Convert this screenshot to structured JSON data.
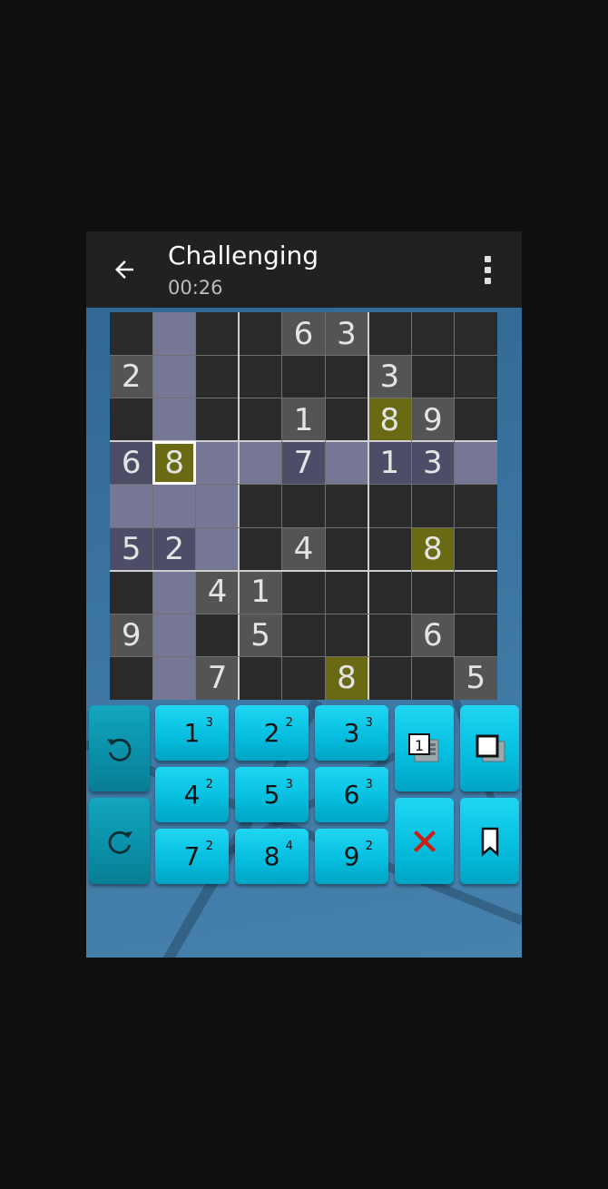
{
  "toolbar": {
    "title": "Challenging",
    "timer": "00:26",
    "back_icon": "arrow-left-icon",
    "menu_icon": "more-vertical-icon"
  },
  "colors": {
    "given": "#545454",
    "empty": "#2a2a2a",
    "highlight": "#767695",
    "highlight_given": "#4d4d68",
    "match": "#6a6a14"
  },
  "board": {
    "rows": [
      [
        "",
        "",
        "",
        "",
        "6",
        "3",
        "",
        "",
        ""
      ],
      [
        "2",
        "",
        "",
        "",
        "",
        "",
        "3",
        "",
        ""
      ],
      [
        "",
        "",
        "",
        "",
        "1",
        "",
        "8",
        "9",
        ""
      ],
      [
        "6",
        "8",
        "",
        "",
        "7",
        "",
        "1",
        "3",
        ""
      ],
      [
        "",
        "",
        "",
        "",
        "",
        "",
        "",
        "",
        ""
      ],
      [
        "5",
        "2",
        "",
        "",
        "4",
        "",
        "",
        "8",
        ""
      ],
      [
        "",
        "",
        "4",
        "1",
        "",
        "",
        "",
        "",
        ""
      ],
      [
        "9",
        "",
        "",
        "5",
        "",
        "",
        "",
        "6",
        ""
      ],
      [
        "",
        "",
        "7",
        "",
        "",
        "8",
        "",
        "",
        "5"
      ]
    ],
    "selected": [
      3,
      1
    ],
    "selected_value": "8"
  },
  "keypad": {
    "numbers": [
      {
        "label": "1",
        "count": "3"
      },
      {
        "label": "2",
        "count": "2"
      },
      {
        "label": "3",
        "count": "3"
      },
      {
        "label": "4",
        "count": "2"
      },
      {
        "label": "5",
        "count": "3"
      },
      {
        "label": "6",
        "count": "3"
      },
      {
        "label": "7",
        "count": "2"
      },
      {
        "label": "8",
        "count": "4"
      },
      {
        "label": "9",
        "count": "2"
      }
    ],
    "undo_icon": "undo-icon",
    "redo_icon": "redo-icon",
    "notes_icon": "pencil-notes-icon",
    "fill_icon": "square-select-icon",
    "clear_icon": "red-x-icon",
    "bookmark_icon": "bookmark-icon"
  }
}
